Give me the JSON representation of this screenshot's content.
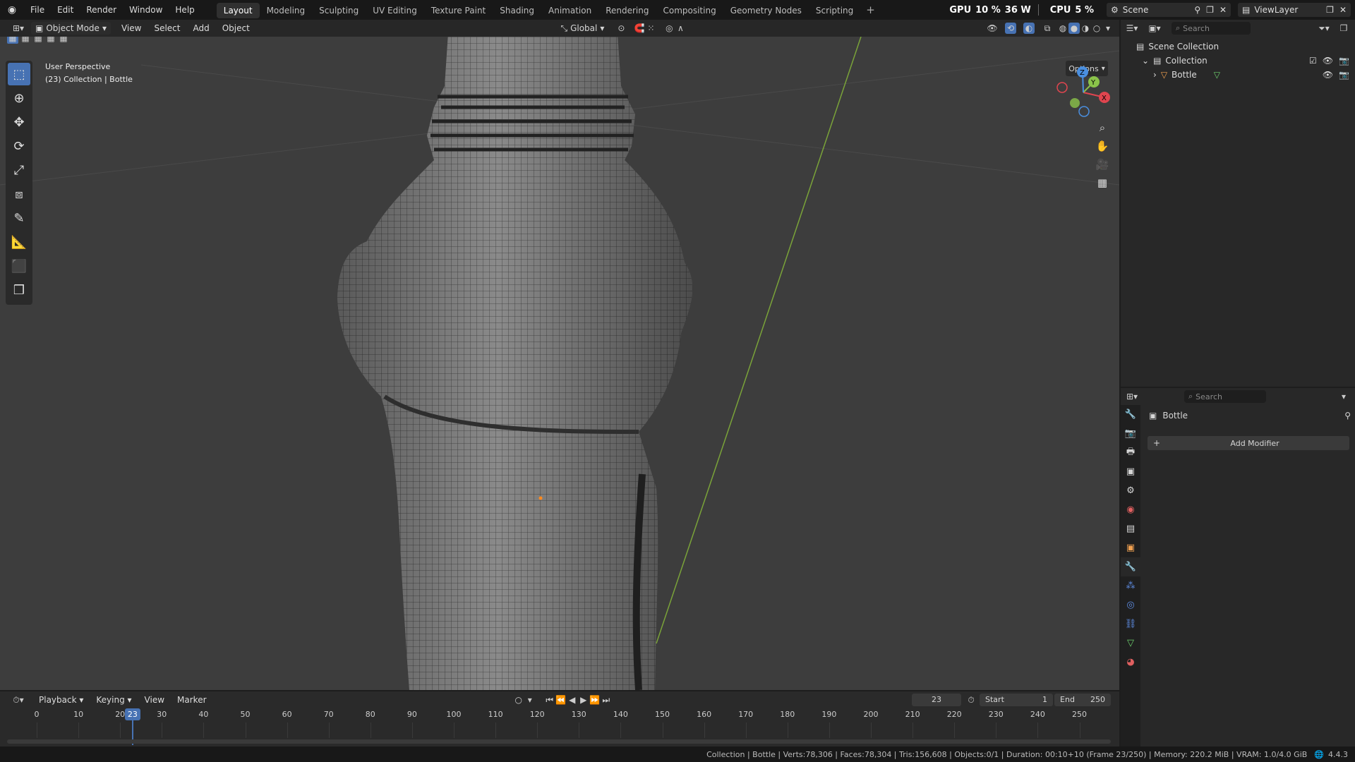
{
  "topbar": {
    "menus": [
      "File",
      "Edit",
      "Render",
      "Window",
      "Help"
    ],
    "workspaces": [
      "Layout",
      "Modeling",
      "Sculpting",
      "UV Editing",
      "Texture Paint",
      "Shading",
      "Animation",
      "Rendering",
      "Compositing",
      "Geometry Nodes",
      "Scripting"
    ],
    "active_workspace": "Layout",
    "plus": "+",
    "gpu_label": "GPU",
    "gpu_value": "10 %",
    "gpu_power": "36 W",
    "cpu_label": "CPU",
    "cpu_value": "5 %",
    "scene_name": "Scene",
    "view_layer": "ViewLayer"
  },
  "viewport_header": {
    "mode": "Object Mode",
    "menus": [
      "View",
      "Select",
      "Add",
      "Object"
    ],
    "transform_orientation": "Global",
    "options": "Options"
  },
  "viewport": {
    "perspective": "User Perspective",
    "collection_info": "(23) Collection | Bottle",
    "gizmo_axes": {
      "x": "X",
      "y": "Y",
      "z": "Z"
    }
  },
  "outliner": {
    "search_placeholder": "Search",
    "scene_collection": "Scene Collection",
    "collection": "Collection",
    "object": "Bottle"
  },
  "properties": {
    "search_placeholder": "Search",
    "object_name": "Bottle",
    "add_modifier": "Add Modifier"
  },
  "timeline": {
    "menus": [
      "Playback",
      "Keying",
      "View",
      "Marker"
    ],
    "current_frame": "23",
    "start_label": "Start",
    "start_value": "1",
    "end_label": "End",
    "end_value": "250",
    "ticks": [
      "0",
      "10",
      "20",
      "30",
      "40",
      "50",
      "60",
      "70",
      "80",
      "90",
      "100",
      "110",
      "120",
      "130",
      "140",
      "150",
      "160",
      "170",
      "180",
      "190",
      "200",
      "210",
      "220",
      "230",
      "240",
      "250"
    ],
    "playhead": "23"
  },
  "status": {
    "text": "Collection | Bottle | Verts:78,306 | Faces:78,304 | Tris:156,608 | Objects:0/1 | Duration: 00:10+10 (Frame 23/250) | Memory: 220.2 MiB | VRAM: 1.0/4.0 GiB",
    "version": "4.4.3"
  },
  "colors": {
    "accent": "#4772b3",
    "x_axis": "#e0454f",
    "y_axis": "#8bc34a",
    "z_axis": "#4a8fe0"
  }
}
